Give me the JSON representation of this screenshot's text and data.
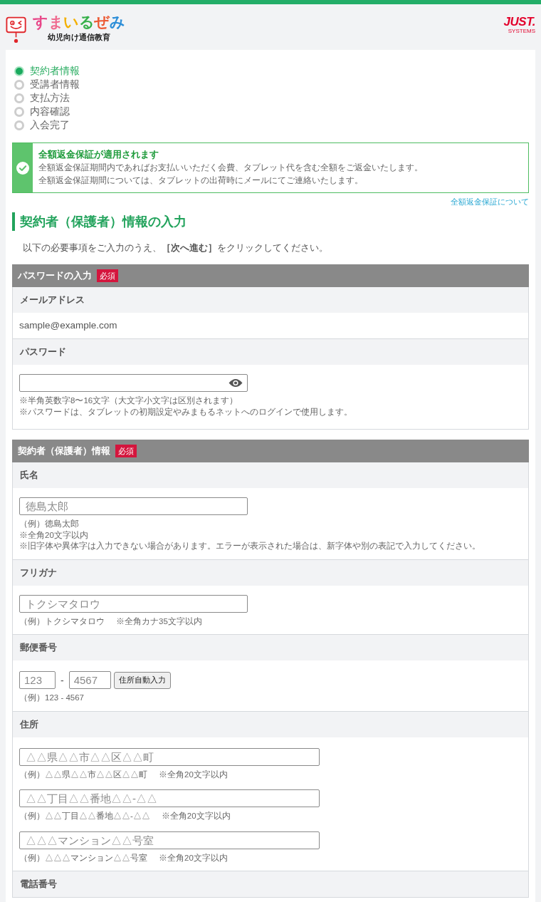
{
  "header": {
    "logo_text": "すまいるぜみ",
    "logo_subtitle": "幼児向け通信教育",
    "brand": "JUST.",
    "brand_sub": "SYSTEMS"
  },
  "steps": [
    {
      "label": "契約者情報",
      "selected": true
    },
    {
      "label": "受講者情報",
      "selected": false
    },
    {
      "label": "支払方法",
      "selected": false
    },
    {
      "label": "内容確認",
      "selected": false
    },
    {
      "label": "入会完了",
      "selected": false
    }
  ],
  "notice": {
    "title": "全額返金保証が適用されます",
    "lines": [
      "全額返金保証期間内であればお支払いいただく会費、タブレット代を含む全額をご返金いたします。",
      "全額返金保証期間については、タブレットの出荷時にメールにてご連絡いたします。"
    ],
    "link": "全額返金保証について"
  },
  "heading": "契約者（保護者）情報の入力",
  "intro": "以下の必要事項をご入力のうえ、**［次へ進む］**をクリックしてください。",
  "sections": [
    {
      "title": "パスワードの入力",
      "badge": "必須",
      "fields": [
        {
          "label": "メールアドレス",
          "kind": "static",
          "value": "sample@example.com"
        },
        {
          "label": "パスワード",
          "kind": "password",
          "entries": [
            {
              "notes": [
                [
                  "※半角英数字8〜16文字（大文字小文字は区別されます）"
                ],
                [
                  "※パスワードは、タブレットの初期設定やみまもるネットへのログインで使用します。"
                ]
              ]
            }
          ]
        }
      ]
    },
    {
      "title": "契約者（保護者）情報",
      "badge": "必須",
      "fields": [
        {
          "label": "氏名",
          "kind": "text",
          "entries": [
            {
              "placeholder": "徳島太郎",
              "notes": [
                [
                  "（例）徳島太郎"
                ],
                [
                  "※全角20文字以内"
                ],
                [
                  "※旧字体や異体字は入力できない場合があります。エラーが表示された場合は、新字体や別の表記で入力してください。"
                ]
              ]
            }
          ]
        },
        {
          "label": "フリガナ",
          "kind": "text",
          "entries": [
            {
              "placeholder": "トクシマタロウ",
              "notes": [
                [
                  "（例）トクシマタロウ",
                  "※全角カナ35文字以内"
                ]
              ]
            }
          ]
        },
        {
          "label": "郵便番号",
          "kind": "postal",
          "inputs": [
            {
              "placeholder": "123"
            },
            {
              "placeholder": "4567"
            }
          ],
          "separator": "-",
          "button": "住所自動入力",
          "notes": [
            [
              "（例）123 - 4567"
            ]
          ]
        },
        {
          "label": "住所",
          "kind": "address",
          "entries": [
            {
              "placeholder": "△△県△△市△△区△△町",
              "notes": [
                [
                  "（例）△△県△△市△△区△△町",
                  "※全角20文字以内"
                ]
              ]
            },
            {
              "placeholder": "△△丁目△△番地△△-△△",
              "notes": [
                [
                  "（例）△△丁目△△番地△△-△△",
                  "※全角20文字以内"
                ]
              ]
            },
            {
              "placeholder": "△△△マンション△△号室",
              "notes": [
                [
                  "（例）△△△マンション△△号室",
                  "※全角20文字以内"
                ]
              ]
            }
          ]
        },
        {
          "label": "電話番号",
          "kind": "text"
        }
      ]
    }
  ]
}
